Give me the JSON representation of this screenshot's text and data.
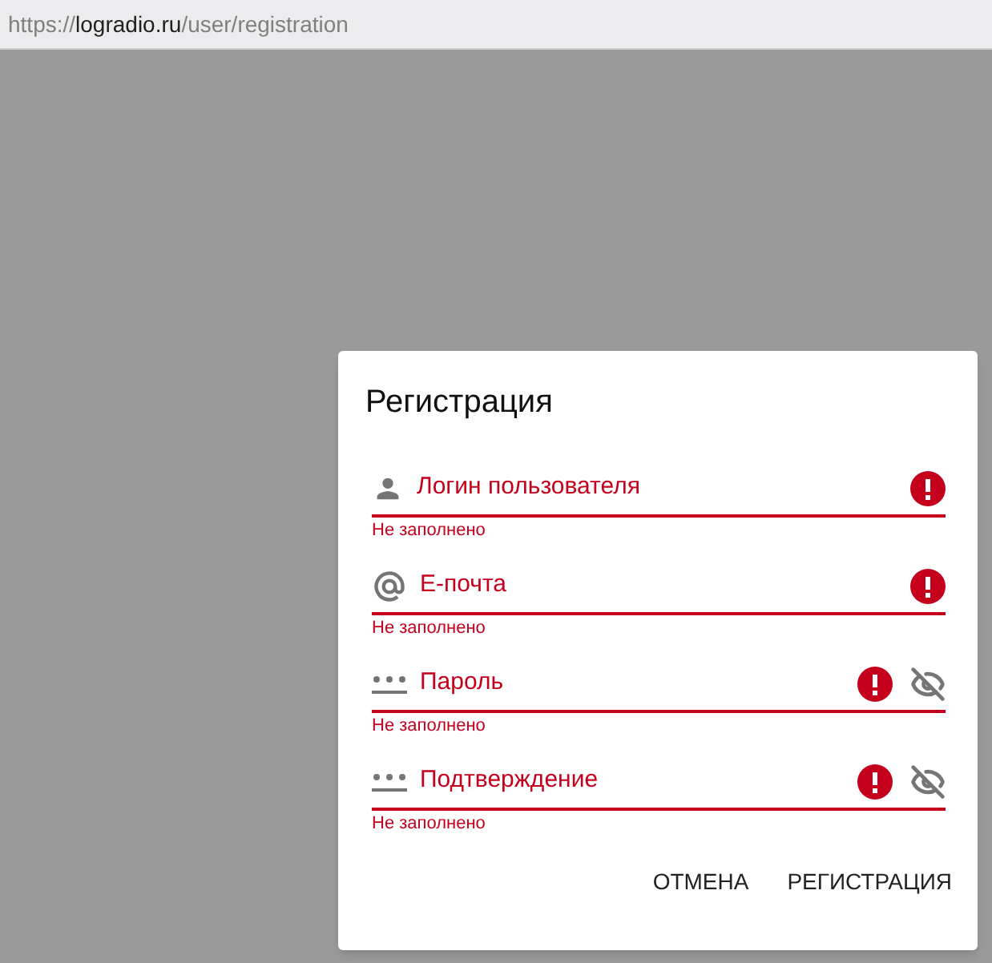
{
  "address_bar": {
    "scheme": "https://",
    "host": "logradio.ru",
    "path": "/user/registration"
  },
  "dialog": {
    "title": "Регистрация",
    "fields": [
      {
        "kind": "user",
        "placeholder": "Логин пользователя",
        "error": true,
        "error_text": "Не заполнено",
        "reveal": false
      },
      {
        "kind": "email",
        "placeholder": "Е-почта",
        "error": true,
        "error_text": "Не заполнено",
        "reveal": false
      },
      {
        "kind": "password",
        "placeholder": "Пароль",
        "error": true,
        "error_text": "Не заполнено",
        "reveal": true
      },
      {
        "kind": "password",
        "placeholder": "Подтверждение",
        "error": true,
        "error_text": "Не заполнено",
        "reveal": true
      }
    ],
    "buttons": [
      "ОТМЕНА",
      "РЕГИСТРАЦИЯ"
    ]
  }
}
